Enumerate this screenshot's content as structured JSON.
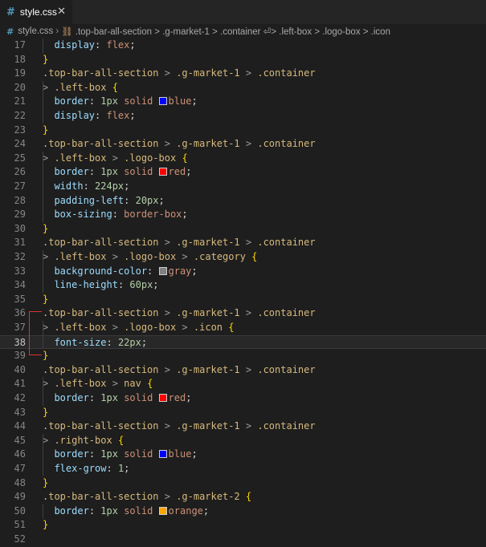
{
  "tab": {
    "icon": "#",
    "label": "style.css",
    "close": "✕"
  },
  "breadcrumb": [
    "style.css",
    ".top-bar-all-section > .g-market-1 > .container ⏎> .left-box > .logo-box > .icon"
  ],
  "colors": {
    "blue": "#0000ff",
    "red": "#ff0000",
    "gray": "#808080",
    "orange": "#ffa500"
  },
  "lines": [
    {
      "n": "17",
      "t": [
        [
          "  ",
          ""
        ],
        [
          "display",
          "prop"
        ],
        [
          ": ",
          ""
        ],
        [
          "flex",
          "kw"
        ],
        [
          ";",
          ""
        ]
      ]
    },
    {
      "n": "18",
      "t": [
        [
          "}",
          "brace"
        ]
      ]
    },
    {
      "n": "19",
      "t": [
        [
          ".top-bar-all-section",
          "sel"
        ],
        [
          " > ",
          "cmb"
        ],
        [
          ".g-market-1",
          "sel"
        ],
        [
          " > ",
          "cmb"
        ],
        [
          ".container",
          "sel"
        ]
      ]
    },
    {
      "n": "20",
      "t": [
        [
          "> ",
          "cmb"
        ],
        [
          ".left-box",
          "sel"
        ],
        [
          " ",
          ""
        ],
        [
          "{",
          "brace"
        ]
      ]
    },
    {
      "n": "21",
      "t": [
        [
          "  ",
          ""
        ],
        [
          "border",
          "prop"
        ],
        [
          ": ",
          ""
        ],
        [
          "1px",
          "num"
        ],
        [
          " ",
          ""
        ],
        [
          "solid",
          "kw"
        ],
        [
          " ",
          ""
        ],
        [
          "",
          "sw:blue"
        ],
        [
          "blue",
          "kw"
        ],
        [
          ";",
          ""
        ]
      ]
    },
    {
      "n": "22",
      "t": [
        [
          "  ",
          ""
        ],
        [
          "display",
          "prop"
        ],
        [
          ": ",
          ""
        ],
        [
          "flex",
          "kw"
        ],
        [
          ";",
          ""
        ]
      ]
    },
    {
      "n": "23",
      "t": [
        [
          "}",
          "brace"
        ]
      ]
    },
    {
      "n": "24",
      "t": [
        [
          ".top-bar-all-section",
          "sel"
        ],
        [
          " > ",
          "cmb"
        ],
        [
          ".g-market-1",
          "sel"
        ],
        [
          " > ",
          "cmb"
        ],
        [
          ".container",
          "sel"
        ]
      ]
    },
    {
      "n": "25",
      "t": [
        [
          "> ",
          "cmb"
        ],
        [
          ".left-box",
          "sel"
        ],
        [
          " > ",
          "cmb"
        ],
        [
          ".logo-box",
          "sel"
        ],
        [
          " ",
          ""
        ],
        [
          "{",
          "brace"
        ]
      ]
    },
    {
      "n": "26",
      "t": [
        [
          "  ",
          ""
        ],
        [
          "border",
          "prop"
        ],
        [
          ": ",
          ""
        ],
        [
          "1px",
          "num"
        ],
        [
          " ",
          ""
        ],
        [
          "solid",
          "kw"
        ],
        [
          " ",
          ""
        ],
        [
          "",
          "sw:red"
        ],
        [
          "red",
          "kw"
        ],
        [
          ";",
          ""
        ]
      ]
    },
    {
      "n": "27",
      "t": [
        [
          "  ",
          ""
        ],
        [
          "width",
          "prop"
        ],
        [
          ": ",
          ""
        ],
        [
          "224px",
          "num"
        ],
        [
          ";",
          ""
        ]
      ]
    },
    {
      "n": "28",
      "t": [
        [
          "  ",
          ""
        ],
        [
          "padding-left",
          "prop"
        ],
        [
          ": ",
          ""
        ],
        [
          "20px",
          "num"
        ],
        [
          ";",
          ""
        ]
      ]
    },
    {
      "n": "29",
      "t": [
        [
          "  ",
          ""
        ],
        [
          "box-sizing",
          "prop"
        ],
        [
          ": ",
          ""
        ],
        [
          "border-box",
          "kw"
        ],
        [
          ";",
          ""
        ]
      ]
    },
    {
      "n": "30",
      "t": [
        [
          "}",
          "brace"
        ]
      ]
    },
    {
      "n": "31",
      "t": [
        [
          ".top-bar-all-section",
          "sel"
        ],
        [
          " > ",
          "cmb"
        ],
        [
          ".g-market-1",
          "sel"
        ],
        [
          " > ",
          "cmb"
        ],
        [
          ".container",
          "sel"
        ]
      ]
    },
    {
      "n": "32",
      "t": [
        [
          "> ",
          "cmb"
        ],
        [
          ".left-box",
          "sel"
        ],
        [
          " > ",
          "cmb"
        ],
        [
          ".logo-box",
          "sel"
        ],
        [
          " > ",
          "cmb"
        ],
        [
          ".category",
          "sel"
        ],
        [
          " ",
          ""
        ],
        [
          "{",
          "brace"
        ]
      ]
    },
    {
      "n": "33",
      "t": [
        [
          "  ",
          ""
        ],
        [
          "background-color",
          "prop"
        ],
        [
          ": ",
          ""
        ],
        [
          "",
          "sw:gray"
        ],
        [
          "gray",
          "kw"
        ],
        [
          ";",
          ""
        ]
      ]
    },
    {
      "n": "34",
      "t": [
        [
          "  ",
          ""
        ],
        [
          "line-height",
          "prop"
        ],
        [
          ": ",
          ""
        ],
        [
          "60px",
          "num"
        ],
        [
          ";",
          ""
        ]
      ]
    },
    {
      "n": "35",
      "t": [
        [
          "}",
          "brace"
        ]
      ]
    },
    {
      "n": "36",
      "t": [
        [
          ".top-bar-all-section",
          "sel"
        ],
        [
          " > ",
          "cmb"
        ],
        [
          ".g-market-1",
          "sel"
        ],
        [
          " > ",
          "cmb"
        ],
        [
          ".container",
          "sel"
        ]
      ]
    },
    {
      "n": "37",
      "t": [
        [
          "> ",
          "cmb"
        ],
        [
          ".left-box",
          "sel"
        ],
        [
          " > ",
          "cmb"
        ],
        [
          ".logo-box",
          "sel"
        ],
        [
          " > ",
          "cmb"
        ],
        [
          ".icon",
          "sel"
        ],
        [
          " ",
          ""
        ],
        [
          "{",
          "brace"
        ]
      ]
    },
    {
      "n": "38",
      "t": [
        [
          "  ",
          ""
        ],
        [
          "font-size",
          "prop"
        ],
        [
          ": ",
          ""
        ],
        [
          "22px",
          "num"
        ],
        [
          ";",
          ""
        ]
      ],
      "active": true
    },
    {
      "n": "39",
      "t": [
        [
          "}",
          "brace"
        ]
      ]
    },
    {
      "n": "40",
      "t": [
        [
          ".top-bar-all-section",
          "sel"
        ],
        [
          " > ",
          "cmb"
        ],
        [
          ".g-market-1",
          "sel"
        ],
        [
          " > ",
          "cmb"
        ],
        [
          ".container",
          "sel"
        ]
      ]
    },
    {
      "n": "41",
      "t": [
        [
          "> ",
          "cmb"
        ],
        [
          ".left-box",
          "sel"
        ],
        [
          " > ",
          "cmb"
        ],
        [
          "nav",
          "sel"
        ],
        [
          " ",
          ""
        ],
        [
          "{",
          "brace"
        ]
      ]
    },
    {
      "n": "42",
      "t": [
        [
          "  ",
          ""
        ],
        [
          "border",
          "prop"
        ],
        [
          ": ",
          ""
        ],
        [
          "1px",
          "num"
        ],
        [
          " ",
          ""
        ],
        [
          "solid",
          "kw"
        ],
        [
          " ",
          ""
        ],
        [
          "",
          "sw:red"
        ],
        [
          "red",
          "kw"
        ],
        [
          ";",
          ""
        ]
      ]
    },
    {
      "n": "43",
      "t": [
        [
          "}",
          "brace"
        ]
      ]
    },
    {
      "n": "44",
      "t": [
        [
          ".top-bar-all-section",
          "sel"
        ],
        [
          " > ",
          "cmb"
        ],
        [
          ".g-market-1",
          "sel"
        ],
        [
          " > ",
          "cmb"
        ],
        [
          ".container",
          "sel"
        ]
      ]
    },
    {
      "n": "45",
      "t": [
        [
          "> ",
          "cmb"
        ],
        [
          ".right-box",
          "sel"
        ],
        [
          " ",
          ""
        ],
        [
          "{",
          "brace"
        ]
      ]
    },
    {
      "n": "46",
      "t": [
        [
          "  ",
          ""
        ],
        [
          "border",
          "prop"
        ],
        [
          ": ",
          ""
        ],
        [
          "1px",
          "num"
        ],
        [
          " ",
          ""
        ],
        [
          "solid",
          "kw"
        ],
        [
          " ",
          ""
        ],
        [
          "",
          "sw:blue"
        ],
        [
          "blue",
          "kw"
        ],
        [
          ";",
          ""
        ]
      ]
    },
    {
      "n": "47",
      "t": [
        [
          "  ",
          ""
        ],
        [
          "flex-grow",
          "prop"
        ],
        [
          ": ",
          ""
        ],
        [
          "1",
          "num"
        ],
        [
          ";",
          ""
        ]
      ]
    },
    {
      "n": "48",
      "t": [
        [
          "}",
          "brace"
        ]
      ]
    },
    {
      "n": "49",
      "t": [
        [
          ".top-bar-all-section",
          "sel"
        ],
        [
          " > ",
          "cmb"
        ],
        [
          ".g-market-2",
          "sel"
        ],
        [
          " ",
          ""
        ],
        [
          "{",
          "brace"
        ]
      ]
    },
    {
      "n": "50",
      "t": [
        [
          "  ",
          ""
        ],
        [
          "border",
          "prop"
        ],
        [
          ": ",
          ""
        ],
        [
          "1px",
          "num"
        ],
        [
          " ",
          ""
        ],
        [
          "solid",
          "kw"
        ],
        [
          " ",
          ""
        ],
        [
          "",
          "sw:orange"
        ],
        [
          "orange",
          "kw"
        ],
        [
          ";",
          ""
        ]
      ]
    },
    {
      "n": "51",
      "t": [
        [
          "}",
          "brace"
        ]
      ]
    },
    {
      "n": "52",
      "t": []
    }
  ]
}
